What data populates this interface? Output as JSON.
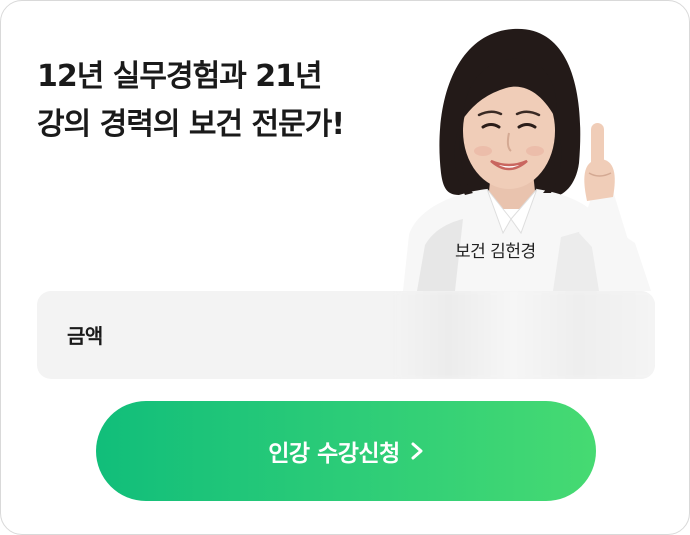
{
  "headline": {
    "line1": "12년 실무경험과 21년",
    "line2": "강의 경력의 보건 전문가!"
  },
  "instructor": {
    "name_tag": "보건 김헌경"
  },
  "price": {
    "label": "금액",
    "value_blurred": true
  },
  "cta": {
    "label": "인강 수강신청",
    "icon": "chevron-right-icon"
  },
  "colors": {
    "accent_start": "#11be7a",
    "accent_end": "#46da72",
    "price_bg": "#f3f3f3",
    "headline": "#1a1a1a"
  }
}
